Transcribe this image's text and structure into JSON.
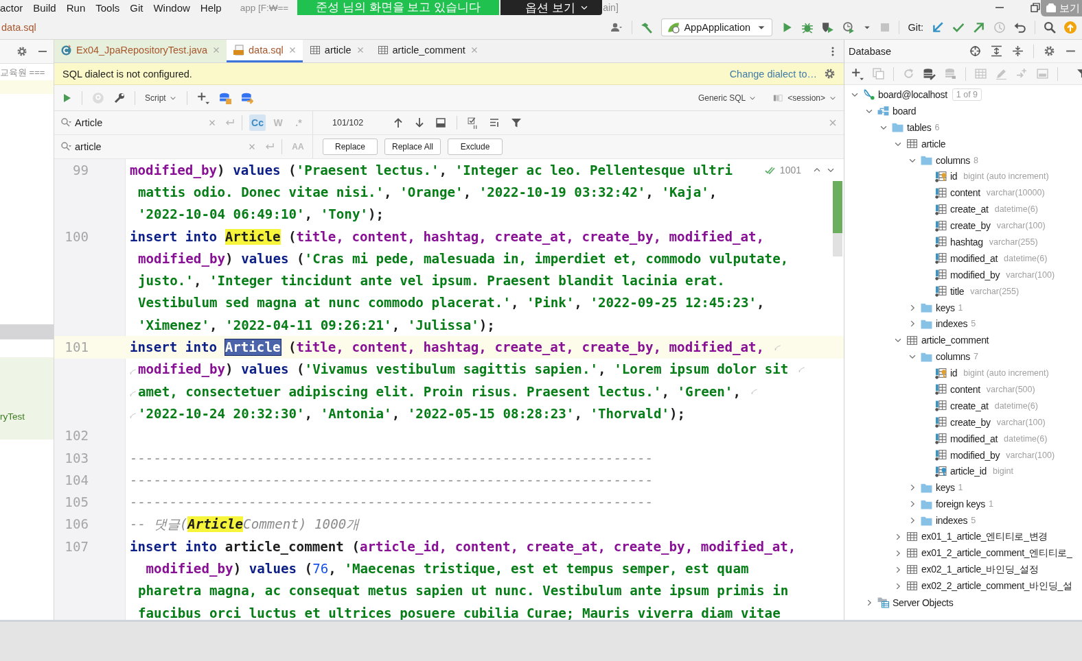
{
  "menu_bar": {
    "items": [
      "actor",
      "Build",
      "Run",
      "Tools",
      "Git",
      "Window",
      "Help"
    ],
    "title_start": "app [F:₩==",
    "title_end": "ain]"
  },
  "share_banner": {
    "message": "준성 님의 화면을 보고 있습니다",
    "options_button": "옵션 보기"
  },
  "corner_overlay": {
    "label": "보기"
  },
  "navigation_bar": {
    "breadcrumb": "data.sql",
    "run_configuration": "AppApplication",
    "git_label": "Git:"
  },
  "project_panel": {
    "rows": [
      {
        "text": "교육원 ==="
      },
      {
        "text": "ryTest"
      }
    ]
  },
  "editor_tabs": [
    {
      "label": "Ex04_JpaRepositoryTest.java",
      "kind": "java-test",
      "selected": false,
      "color": "#a8572c"
    },
    {
      "label": "data.sql",
      "kind": "sql",
      "selected": true,
      "color": "#a8572c"
    },
    {
      "label": "article",
      "kind": "table",
      "selected": false,
      "color": "#1e1e1e"
    },
    {
      "label": "article_comment",
      "kind": "table",
      "selected": false,
      "color": "#1e1e1e"
    }
  ],
  "dialect_banner": {
    "message": "SQL dialect is not configured.",
    "link": "Change dialect to…"
  },
  "sql_toolbar": {
    "script_menu": "Script",
    "dialect": "Generic SQL",
    "session": "<session>"
  },
  "find": {
    "search": "Article",
    "options": [
      {
        "label": "Cc",
        "selected": true
      },
      {
        "label": "W",
        "selected": false
      },
      {
        "label": ".*",
        "selected": false
      }
    ],
    "match_count": "101/102",
    "replace": "article",
    "preserve_case": "AA",
    "buttons": [
      "Replace",
      "Replace All",
      "Exclude"
    ]
  },
  "editor": {
    "inspection_count": "1001",
    "lines": [
      {
        "number": "99",
        "current": false,
        "soft_wraps": false,
        "rows": [
          {
            "parts": [
              {
                "kind": "column",
                "text": "modified_by"
              },
              {
                "kind": "plain",
                "text": ") "
              },
              {
                "kind": "keyword",
                "text": "values"
              },
              {
                "kind": "plain",
                "text": " ("
              },
              {
                "kind": "string",
                "text": "'Praesent lectus.'"
              },
              {
                "kind": "plain",
                "text": ", "
              },
              {
                "kind": "string",
                "text": "'Integer ac leo. Pellentesque ultri"
              }
            ]
          },
          {
            "parts": [
              {
                "kind": "string",
                "text": "mattis odio. Donec vitae nisi.'"
              },
              {
                "kind": "plain",
                "text": ", "
              },
              {
                "kind": "string",
                "text": "'Orange'"
              },
              {
                "kind": "plain",
                "text": ", "
              },
              {
                "kind": "string",
                "text": "'2022-10-19 03:32:42'"
              },
              {
                "kind": "plain",
                "text": ", "
              },
              {
                "kind": "string",
                "text": "'Kaja'"
              },
              {
                "kind": "plain",
                "text": ","
              }
            ]
          },
          {
            "parts": [
              {
                "kind": "string",
                "text": "'2022-10-04 06:49:10'"
              },
              {
                "kind": "plain",
                "text": ", "
              },
              {
                "kind": "string",
                "text": "'Tony'"
              },
              {
                "kind": "plain",
                "text": ");"
              }
            ]
          }
        ]
      },
      {
        "number": "100",
        "current": false,
        "soft_wraps": false,
        "rows": [
          {
            "parts": [
              {
                "kind": "keyword",
                "text": "insert into "
              },
              {
                "kind": "match",
                "text": "Article"
              },
              {
                "kind": "plain",
                "text": " ("
              },
              {
                "kind": "column",
                "text": "title, content, hashtag, create_at, create_by, modified_at,"
              }
            ]
          },
          {
            "parts": [
              {
                "kind": "column",
                "text": "modified_by"
              },
              {
                "kind": "plain",
                "text": ") "
              },
              {
                "kind": "keyword",
                "text": "values"
              },
              {
                "kind": "plain",
                "text": " ("
              },
              {
                "kind": "string",
                "text": "'Cras mi pede, malesuada in, imperdiet et, commodo vulputate,"
              }
            ]
          },
          {
            "parts": [
              {
                "kind": "string",
                "text": "justo.'"
              },
              {
                "kind": "plain",
                "text": ", "
              },
              {
                "kind": "string",
                "text": "'Integer tincidunt ante vel ipsum. Praesent blandit lacinia erat."
              }
            ]
          },
          {
            "parts": [
              {
                "kind": "string",
                "text": "Vestibulum sed magna at nunc commodo placerat.'"
              },
              {
                "kind": "plain",
                "text": ", "
              },
              {
                "kind": "string",
                "text": "'Pink'"
              },
              {
                "kind": "plain",
                "text": ", "
              },
              {
                "kind": "string",
                "text": "'2022-09-25 12:45:23'"
              },
              {
                "kind": "plain",
                "text": ","
              }
            ]
          },
          {
            "parts": [
              {
                "kind": "string",
                "text": "'Ximenez'"
              },
              {
                "kind": "plain",
                "text": ", "
              },
              {
                "kind": "string",
                "text": "'2022-04-11 09:26:21'"
              },
              {
                "kind": "plain",
                "text": ", "
              },
              {
                "kind": "string",
                "text": "'Julissa'"
              },
              {
                "kind": "plain",
                "text": ");"
              }
            ]
          }
        ]
      },
      {
        "number": "101",
        "current": true,
        "soft_wraps": true,
        "rows": [
          {
            "parts": [
              {
                "kind": "keyword",
                "text": "insert into "
              },
              {
                "kind": "current-match",
                "text": "Article"
              },
              {
                "kind": "plain",
                "text": " ("
              },
              {
                "kind": "column",
                "text": "title, content, hashtag, create_at, create_by, modified_at,"
              }
            ]
          },
          {
            "parts": [
              {
                "kind": "column",
                "text": "modified_by"
              },
              {
                "kind": "plain",
                "text": ") "
              },
              {
                "kind": "keyword",
                "text": "values"
              },
              {
                "kind": "plain",
                "text": " ("
              },
              {
                "kind": "string",
                "text": "'Vivamus vestibulum sagittis sapien.'"
              },
              {
                "kind": "plain",
                "text": ", "
              },
              {
                "kind": "string",
                "text": "'Lorem ipsum dolor sit"
              }
            ]
          },
          {
            "parts": [
              {
                "kind": "string",
                "text": "amet, consectetuer adipiscing elit. Proin risus. Praesent lectus.'"
              },
              {
                "kind": "plain",
                "text": ", "
              },
              {
                "kind": "string",
                "text": "'Green'"
              },
              {
                "kind": "plain",
                "text": ","
              }
            ]
          },
          {
            "parts": [
              {
                "kind": "string",
                "text": "'2022-10-24 20:32:30'"
              },
              {
                "kind": "plain",
                "text": ", "
              },
              {
                "kind": "string",
                "text": "'Antonia'"
              },
              {
                "kind": "plain",
                "text": ", "
              },
              {
                "kind": "string",
                "text": "'2022-05-15 08:28:23'"
              },
              {
                "kind": "plain",
                "text": ", "
              },
              {
                "kind": "string",
                "text": "'Thorvald'"
              },
              {
                "kind": "plain",
                "text": ");"
              }
            ]
          }
        ]
      },
      {
        "number": "102",
        "current": false,
        "soft_wraps": false
      },
      {
        "number": "103",
        "current": false,
        "soft_wraps": false,
        "rows": [
          {
            "parts": [
              {
                "kind": "comment",
                "text": "------------------------------------------------------------------"
              }
            ]
          }
        ]
      },
      {
        "number": "104",
        "current": false,
        "soft_wraps": false,
        "rows": [
          {
            "parts": [
              {
                "kind": "comment",
                "text": "------------------------------------------------------------------"
              }
            ]
          }
        ]
      },
      {
        "number": "105",
        "current": false,
        "soft_wraps": false,
        "rows": [
          {
            "parts": [
              {
                "kind": "comment",
                "text": "------------------------------------------------------------------"
              }
            ]
          }
        ]
      },
      {
        "number": "106",
        "current": false,
        "soft_wraps": false,
        "rows": [
          {
            "parts": [
              {
                "kind": "comment",
                "text": "-- 댓글("
              },
              {
                "kind": "comment-match",
                "text": "Article"
              },
              {
                "kind": "comment",
                "text": "Comment) 1000개"
              }
            ]
          }
        ]
      },
      {
        "number": "107",
        "current": false,
        "soft_wraps": false,
        "rows": [
          {
            "parts": [
              {
                "kind": "keyword",
                "text": "insert into "
              },
              {
                "kind": "plain",
                "text": "article_comment ("
              },
              {
                "kind": "column",
                "text": "article_id, content, create_at, create_by, modified_at,"
              }
            ]
          },
          {
            "parts": [
              {
                "kind": "column",
                "text": " modified_by"
              },
              {
                "kind": "plain",
                "text": ") "
              },
              {
                "kind": "keyword",
                "text": "values"
              },
              {
                "kind": "plain",
                "text": " ("
              },
              {
                "kind": "number",
                "text": "76"
              },
              {
                "kind": "plain",
                "text": ", "
              },
              {
                "kind": "string",
                "text": "'Maecenas tristique, est et tempus semper, est quam"
              }
            ]
          },
          {
            "parts": [
              {
                "kind": "string",
                "text": "pharetra magna, ac consequat metus sapien ut nunc. Vestibulum ante ipsum primis in"
              }
            ]
          },
          {
            "parts": [
              {
                "kind": "string",
                "text": "faucibus orci luctus et ultrices posuere cubilia Curae; Mauris viverra diam vitae"
              }
            ]
          }
        ]
      }
    ]
  },
  "database": {
    "title": "Database",
    "tree": [
      {
        "label": "board@localhost",
        "kind": "datasource",
        "badge": "1 of 9",
        "expanded": true,
        "children": [
          {
            "label": "board",
            "kind": "schema",
            "expanded": true,
            "children": [
              {
                "label": "tables",
                "kind": "folder",
                "count": "6",
                "expanded": true,
                "children": [
                  {
                    "label": "article",
                    "kind": "table",
                    "expanded": true,
                    "children": [
                      {
                        "label": "columns",
                        "kind": "folder",
                        "count": "8",
                        "expanded": true,
                        "children": [
                          {
                            "label": "id",
                            "kind": "key-column",
                            "type": "bigint (auto increment)"
                          },
                          {
                            "label": "content",
                            "kind": "column",
                            "type": "varchar(10000)"
                          },
                          {
                            "label": "create_at",
                            "kind": "column",
                            "type": "datetime(6)"
                          },
                          {
                            "label": "create_by",
                            "kind": "column",
                            "type": "varchar(100)"
                          },
                          {
                            "label": "hashtag",
                            "kind": "column",
                            "type": "varchar(255)"
                          },
                          {
                            "label": "modified_at",
                            "kind": "column",
                            "type": "datetime(6)"
                          },
                          {
                            "label": "modified_by",
                            "kind": "column",
                            "type": "varchar(100)"
                          },
                          {
                            "label": "title",
                            "kind": "column",
                            "type": "varchar(255)"
                          }
                        ]
                      },
                      {
                        "label": "keys",
                        "kind": "folder",
                        "count": "1",
                        "expanded": false
                      },
                      {
                        "label": "indexes",
                        "kind": "folder",
                        "count": "5",
                        "expanded": false
                      }
                    ]
                  },
                  {
                    "label": "article_comment",
                    "kind": "table",
                    "expanded": true,
                    "children": [
                      {
                        "label": "columns",
                        "kind": "folder",
                        "count": "7",
                        "expanded": true,
                        "children": [
                          {
                            "label": "id",
                            "kind": "key-column",
                            "type": "bigint (auto increment)"
                          },
                          {
                            "label": "content",
                            "kind": "column",
                            "type": "varchar(500)"
                          },
                          {
                            "label": "create_at",
                            "kind": "column",
                            "type": "datetime(6)"
                          },
                          {
                            "label": "create_by",
                            "kind": "column",
                            "type": "varchar(100)"
                          },
                          {
                            "label": "modified_at",
                            "kind": "column",
                            "type": "datetime(6)"
                          },
                          {
                            "label": "modified_by",
                            "kind": "column",
                            "type": "varchar(100)"
                          },
                          {
                            "label": "article_id",
                            "kind": "foreign-key-column",
                            "type": "bigint"
                          }
                        ]
                      },
                      {
                        "label": "keys",
                        "kind": "folder",
                        "count": "1",
                        "expanded": false
                      },
                      {
                        "label": "foreign keys",
                        "kind": "folder",
                        "count": "1",
                        "expanded": false
                      },
                      {
                        "label": "indexes",
                        "kind": "folder",
                        "count": "5",
                        "expanded": false
                      }
                    ]
                  },
                  {
                    "label": "ex01_1_article_엔티티로_변경",
                    "kind": "table",
                    "expanded": false
                  },
                  {
                    "label": "ex01_2_article_comment_엔티티로_",
                    "kind": "table",
                    "expanded": false
                  },
                  {
                    "label": "ex02_1_article_바인딩_설정",
                    "kind": "table",
                    "expanded": false
                  },
                  {
                    "label": "ex02_2_article_comment_바인딩_설",
                    "kind": "table",
                    "expanded": false
                  }
                ]
              }
            ]
          },
          {
            "label": "Server Objects",
            "kind": "server-objects",
            "expanded": false
          }
        ]
      }
    ]
  }
}
